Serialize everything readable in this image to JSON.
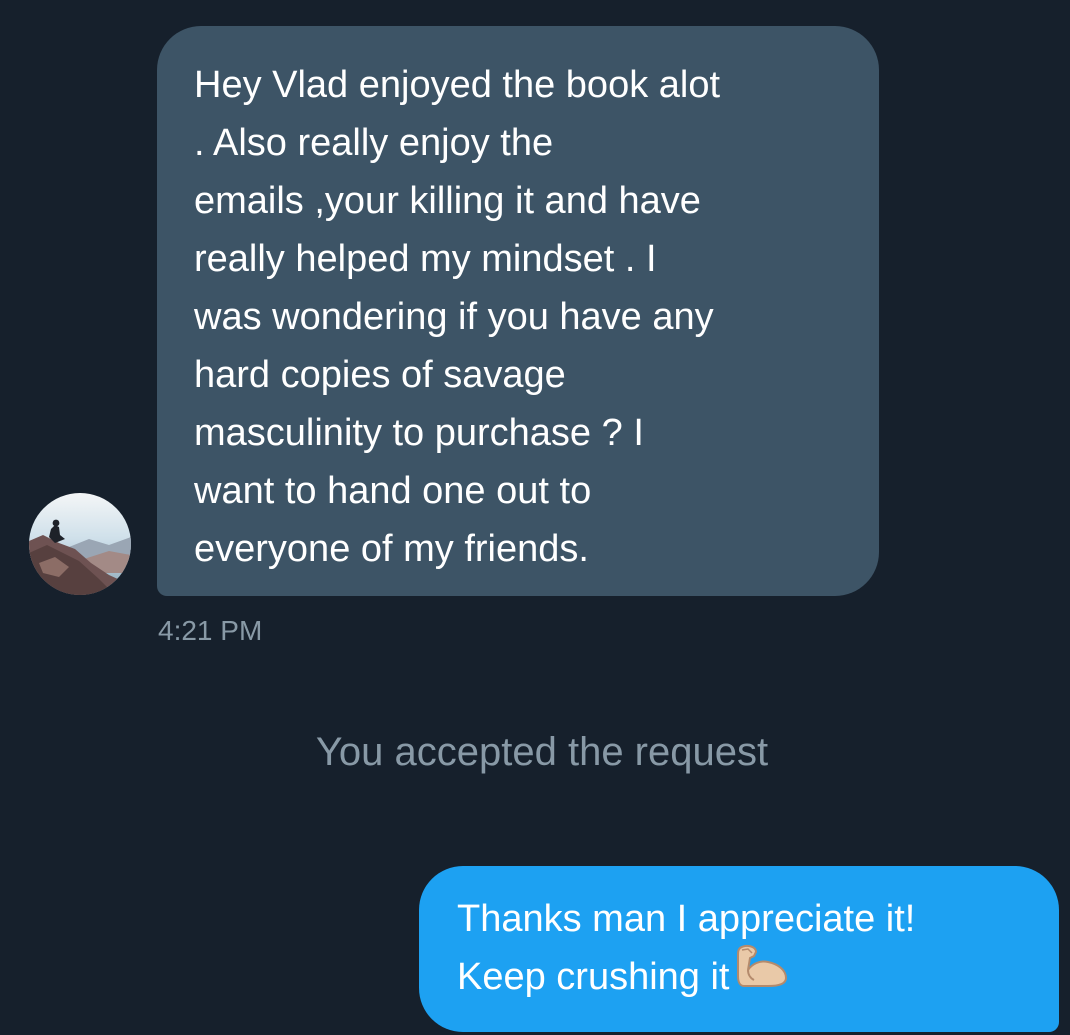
{
  "incoming_message": {
    "text": "Hey Vlad enjoyed the book alot\n. Also really enjoy the\nemails ,your killing it and have\nreally helped my mindset . I\nwas wondering if you have any\nhard copies of savage\nmasculinity to purchase ? I\nwant to hand one out to\neveryone of my friends.",
    "timestamp": "4:21 PM",
    "bubble_color": "#3d5466"
  },
  "system_notice": {
    "text": "You accepted the request"
  },
  "outgoing_message": {
    "line1": "Thanks man I appreciate it!",
    "line2": "Keep crushing it",
    "emoji_icon": "flexed-biceps-icon",
    "bubble_color": "#1da1f2"
  },
  "theme": {
    "background": "#16202c",
    "muted_text": "#8899a6"
  }
}
